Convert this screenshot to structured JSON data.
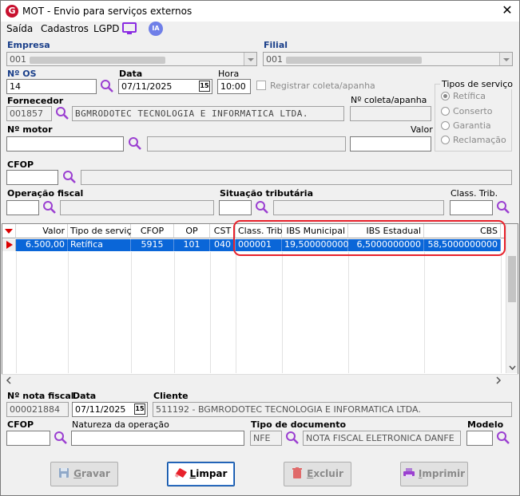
{
  "window": {
    "title": "MOT - Envio para serviços externos",
    "logo": "G",
    "close": "✕"
  },
  "menu": [
    {
      "label": "Saída",
      "hotkey": "S"
    },
    {
      "label": "Cadastros",
      "hotkey": "C"
    },
    {
      "label": "LGPD"
    }
  ],
  "menu_icons": {
    "ia_label": "IA"
  },
  "empresa": {
    "label": "Empresa",
    "code": "001"
  },
  "filial": {
    "label": "Filial",
    "code": "001"
  },
  "os": {
    "label": "Nº  OS",
    "value": "14"
  },
  "data": {
    "label": "Data",
    "value": "07/11/2025",
    "cal": "15"
  },
  "hora": {
    "label": "Hora",
    "value": "10:00"
  },
  "registrar": {
    "label": "Registrar coleta/apanha",
    "checked": false
  },
  "tipos_servico": {
    "label": "Tipos de serviço",
    "options": [
      "Retífica",
      "Conserto",
      "Garantia",
      "Reclamação"
    ],
    "selected": "Retífica"
  },
  "fornecedor": {
    "label": "Fornecedor",
    "code": "001857",
    "name": "BGMRODOTEC TECNOLOGIA E INFORMATICA LTDA."
  },
  "coleta": {
    "label": "Nº coleta/apanha",
    "value": ""
  },
  "motor": {
    "label": "Nº  motor",
    "value": ""
  },
  "valor": {
    "label": "Valor",
    "value": ""
  },
  "cfop_top": {
    "label": "CFOP",
    "value": ""
  },
  "operacao_fiscal": {
    "label": "Operação fiscal"
  },
  "situacao_tributaria": {
    "label": "Situação tributária"
  },
  "class_trib_top": {
    "label": "Class. Trib."
  },
  "grid": {
    "columns": [
      "Valor",
      "Tipo de serviço",
      "CFOP",
      "OP",
      "CST",
      "Class. Trib.",
      "IBS Municipal",
      "IBS Estadual",
      "CBS"
    ],
    "rows": [
      [
        "6.500,00",
        "Retífica",
        "5915",
        "101",
        "040",
        "000001",
        "19,5000000000",
        "6,5000000000",
        "58,5000000000"
      ]
    ]
  },
  "nota": {
    "label": "Nº nota fiscal",
    "value": "000021884"
  },
  "data_nota": {
    "label": "Data",
    "value": "07/11/2025",
    "cal": "15"
  },
  "cliente": {
    "label": "Cliente",
    "value": "511192 - BGMRODOTEC TECNOLOGIA E INFORMATICA LTDA."
  },
  "cfop_bottom": {
    "label": "CFOP",
    "value": ""
  },
  "natureza": {
    "label": "Natureza da operação",
    "value": ""
  },
  "tipo_documento": {
    "label": "Tipo de documento",
    "code": "NFE",
    "name": "NOTA FISCAL ELETRONICA DANFE"
  },
  "modelo": {
    "label": "Modelo",
    "value": ""
  },
  "buttons": {
    "gravar": {
      "first": "G",
      "rest": "ravar"
    },
    "limpar": {
      "first": "L",
      "rest": "impar"
    },
    "excluir": {
      "first": "E",
      "rest": "xcluir"
    },
    "imprimir": {
      "first": "I",
      "rest": "mprimir"
    }
  },
  "colors": {
    "accent": "#0a66d8",
    "highlight": "#e8212b",
    "brand": "#c8102e",
    "magnifier": "#9b3fd1"
  }
}
